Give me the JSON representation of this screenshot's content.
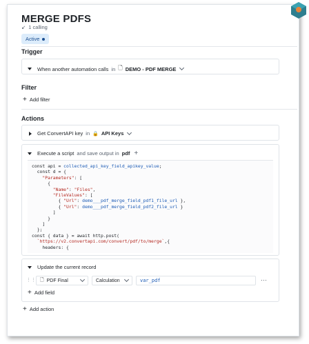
{
  "header": {
    "title": "MERGE PDFS",
    "calling": "1 calling",
    "status": "Active"
  },
  "trigger": {
    "label": "Trigger",
    "text": "When another automation calls",
    "in": "in",
    "target": "DEMO - PDF MERGE"
  },
  "filter": {
    "label": "Filter",
    "add": "Add filter"
  },
  "actions": {
    "label": "Actions",
    "step1": {
      "text": "Get ConvertAPI key",
      "in": "in",
      "target": "API Keys"
    },
    "step2": {
      "text": "Execute a script",
      "suffix": "and save output in",
      "output": "pdf"
    },
    "step3": {
      "text": "Update the current record",
      "field": "PDF Final",
      "mode": "Calculation",
      "value": "var_pdf",
      "add_field": "Add field"
    },
    "add_action": "Add action"
  },
  "code_lines": [
    "const api = collected_api_key_field_apikey_value;",
    "  const d = {",
    "    \"Parameters\": [",
    "      {",
    "        \"Name\": \"Files\",",
    "        \"FileValues\": [",
    "          { \"Url\": demo___pdf_merge_field_pdf1_file_url },",
    "          { \"Url\": demo___pdf_merge_field_pdf2_file_url }",
    "        ]",
    "      }",
    "    ]",
    "  };",
    "const { data } = await http.post(",
    "  `https://v2.convertapi.com/convert/pdf/to/merge`,{",
    "    headers: {"
  ]
}
